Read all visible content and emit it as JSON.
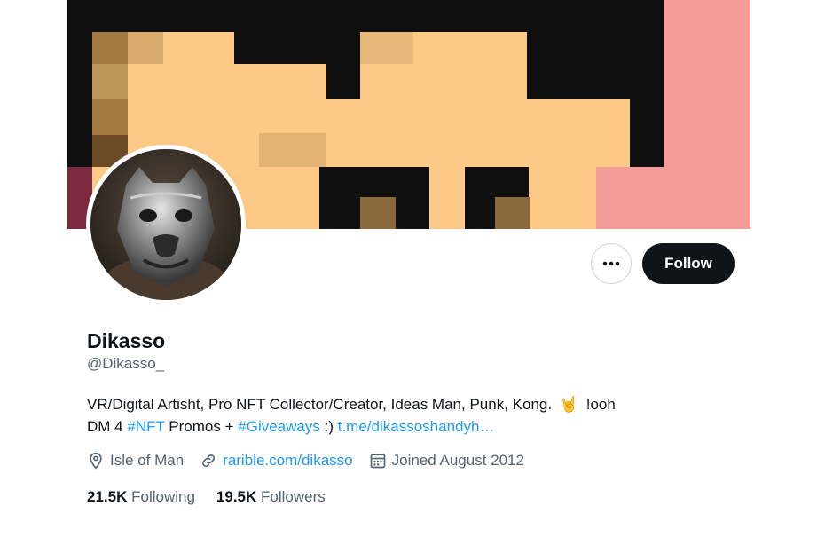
{
  "profile": {
    "display_name": "Dikasso",
    "handle": "@Dikasso_",
    "bio": {
      "line1": "VR/Digital Artisht, Pro NFT Collector/Creator, Ideas Man, Punk, Kong.",
      "emoji": "🤘",
      "line1_end": "!ooh",
      "line2_start": "DM 4",
      "tag1": "#NFT",
      "mid": "Promos +",
      "tag2": "#Giveaways",
      "smile": ":)",
      "url": "t.me/dikassoshandyh…"
    },
    "location": "Isle of Man",
    "website": "rarible.com/dikasso",
    "joined": "Joined August 2012",
    "following_count": "21.5K",
    "following_label": "Following",
    "followers_count": "19.5K",
    "followers_label": "Followers"
  },
  "actions": {
    "more_label": "•••",
    "follow_label": "Follow"
  },
  "icons": {
    "more": "more-horizontal-icon",
    "location": "location-pin-icon",
    "link": "link-icon",
    "calendar": "calendar-icon"
  },
  "colors": {
    "link": "#1d9bf0",
    "follow_bg": "#0f1419",
    "secondary_text": "#536471",
    "banner_skin": "#fcca86",
    "banner_pink": "#f49c9a"
  }
}
